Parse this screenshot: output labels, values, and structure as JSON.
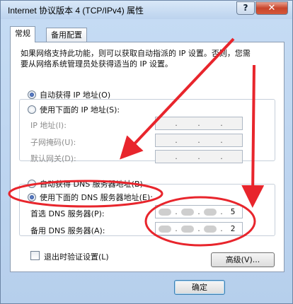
{
  "window": {
    "title": "Internet 协议版本 4 (TCP/IPv4) 属性",
    "help_label": "?",
    "close_label": "✕"
  },
  "tabs": [
    {
      "label": "常规"
    },
    {
      "label": "备用配置"
    }
  ],
  "description": "如果网络支持此功能，则可以获取自动指派的 IP 设置。否则，您需要从网络系统管理员处获得适当的 IP 设置。",
  "ip_section": {
    "auto_label": "自动获得 IP 地址(O)",
    "manual_label": "使用下面的 IP 地址(S):",
    "auto_selected": true,
    "fields": [
      {
        "label": "IP 地址(I):"
      },
      {
        "label": "子网掩码(U):"
      },
      {
        "label": "默认网关(D):"
      }
    ]
  },
  "dns_section": {
    "auto_label": "自动获得 DNS 服务器地址(B)",
    "manual_label": "使用下面的 DNS 服务器地址(E):",
    "manual_selected": true,
    "preferred_label": "首选 DNS 服务器(P):",
    "preferred_value_last": "5",
    "alternate_label": "备用 DNS 服务器(A):",
    "alternate_value_last": "2"
  },
  "validate_label": "退出时验证设置(L)",
  "advanced_label": "高级(V)...",
  "ok_label": "确定",
  "colors": {
    "annotation": "#e8252c"
  }
}
